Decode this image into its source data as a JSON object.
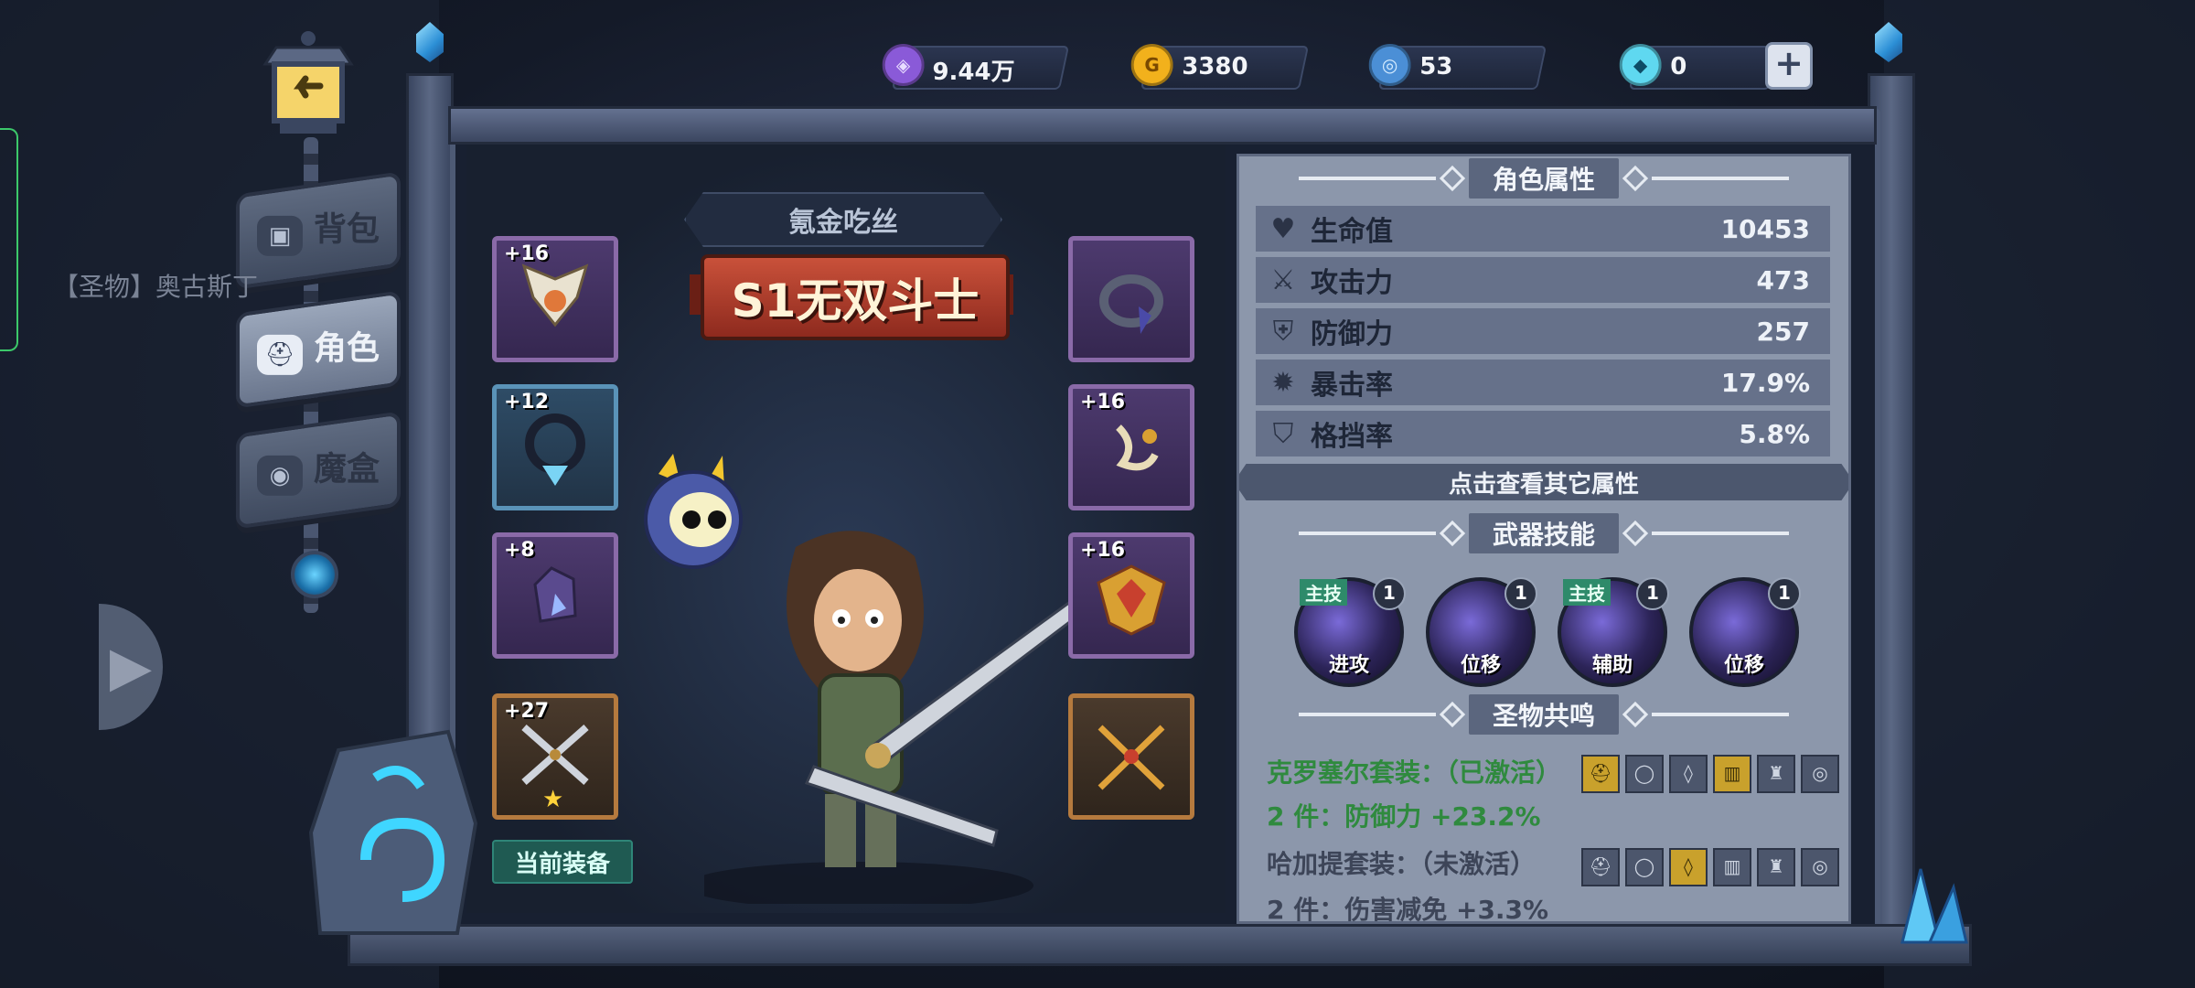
{
  "currencies": [
    {
      "name": "purple-coin",
      "value": "9.44万",
      "color": "#8a5ad8"
    },
    {
      "name": "gold-coin",
      "value": "3380",
      "color": "#f2b11c"
    },
    {
      "name": "blue-orb",
      "value": "53",
      "color": "#4b8fd6"
    },
    {
      "name": "diamond",
      "value": "0",
      "color": "#5fd8f0"
    }
  ],
  "plus_label": "+",
  "nav": {
    "items": [
      {
        "label": "背包",
        "icon": "bag-icon"
      },
      {
        "label": "角色",
        "icon": "helmet-icon"
      },
      {
        "label": "魔盒",
        "icon": "box-icon"
      }
    ],
    "active": "角色"
  },
  "relic_label": "【圣物】奥古斯丁",
  "character": {
    "name": "氪金吃丝",
    "title": "S1无双斗士"
  },
  "equipment": {
    "left": [
      {
        "level": "+16",
        "icon": "winged-crest-icon",
        "rarity": "purple"
      },
      {
        "level": "+12",
        "icon": "necklace-icon",
        "rarity": "blue"
      },
      {
        "level": "+8",
        "icon": "gauntlet-icon",
        "rarity": "purple"
      },
      {
        "level": "+27",
        "icon": "crossed-swords-icon",
        "rarity": "orange",
        "star": "★"
      }
    ],
    "right": [
      {
        "level": "",
        "icon": "ring-icon",
        "rarity": "purple"
      },
      {
        "level": "+16",
        "icon": "amulet-icon",
        "rarity": "purple"
      },
      {
        "level": "+16",
        "icon": "shield-crest-icon",
        "rarity": "purple"
      },
      {
        "level": "",
        "icon": "crossed-swords-icon",
        "rarity": "orange"
      }
    ]
  },
  "current_equip_label": "当前装备",
  "attributes": {
    "header": "角色属性",
    "rows": [
      {
        "icon": "heart-icon",
        "glyph": "♥",
        "label": "生命值",
        "value": "10453"
      },
      {
        "icon": "sword-icon",
        "glyph": "⚔",
        "label": "攻击力",
        "value": "473"
      },
      {
        "icon": "shield-icon",
        "glyph": "⛨",
        "label": "防御力",
        "value": "257"
      },
      {
        "icon": "crit-icon",
        "glyph": "✹",
        "label": "暴击率",
        "value": "17.9%"
      },
      {
        "icon": "block-icon",
        "glyph": "⛉",
        "label": "格挡率",
        "value": "5.8%"
      }
    ],
    "more_label": "点击查看其它属性"
  },
  "weapon_skills": {
    "header": "武器技能",
    "skills": [
      {
        "tag": "主技",
        "level": "1",
        "name": "进攻"
      },
      {
        "tag": "",
        "level": "1",
        "name": "位移"
      },
      {
        "tag": "主技",
        "level": "1",
        "name": "辅助"
      },
      {
        "tag": "",
        "level": "1",
        "name": "位移"
      }
    ]
  },
  "relic_resonance": {
    "header": "圣物共鸣",
    "sets": [
      {
        "name": "克罗塞尔套装：（已激活）",
        "bonus": "2 件：防御力 +23.2%",
        "active": true,
        "pieces": [
          true,
          false,
          false,
          true,
          false,
          false
        ]
      },
      {
        "name": "哈加提套装：（未激活）",
        "bonus": "2 件：伤害减免 +3.3%",
        "active": false,
        "pieces": [
          false,
          false,
          true,
          false,
          false,
          false
        ]
      }
    ]
  },
  "colors": {
    "active_set": "#2f8a3e",
    "inactive_set": "#3d4558"
  }
}
